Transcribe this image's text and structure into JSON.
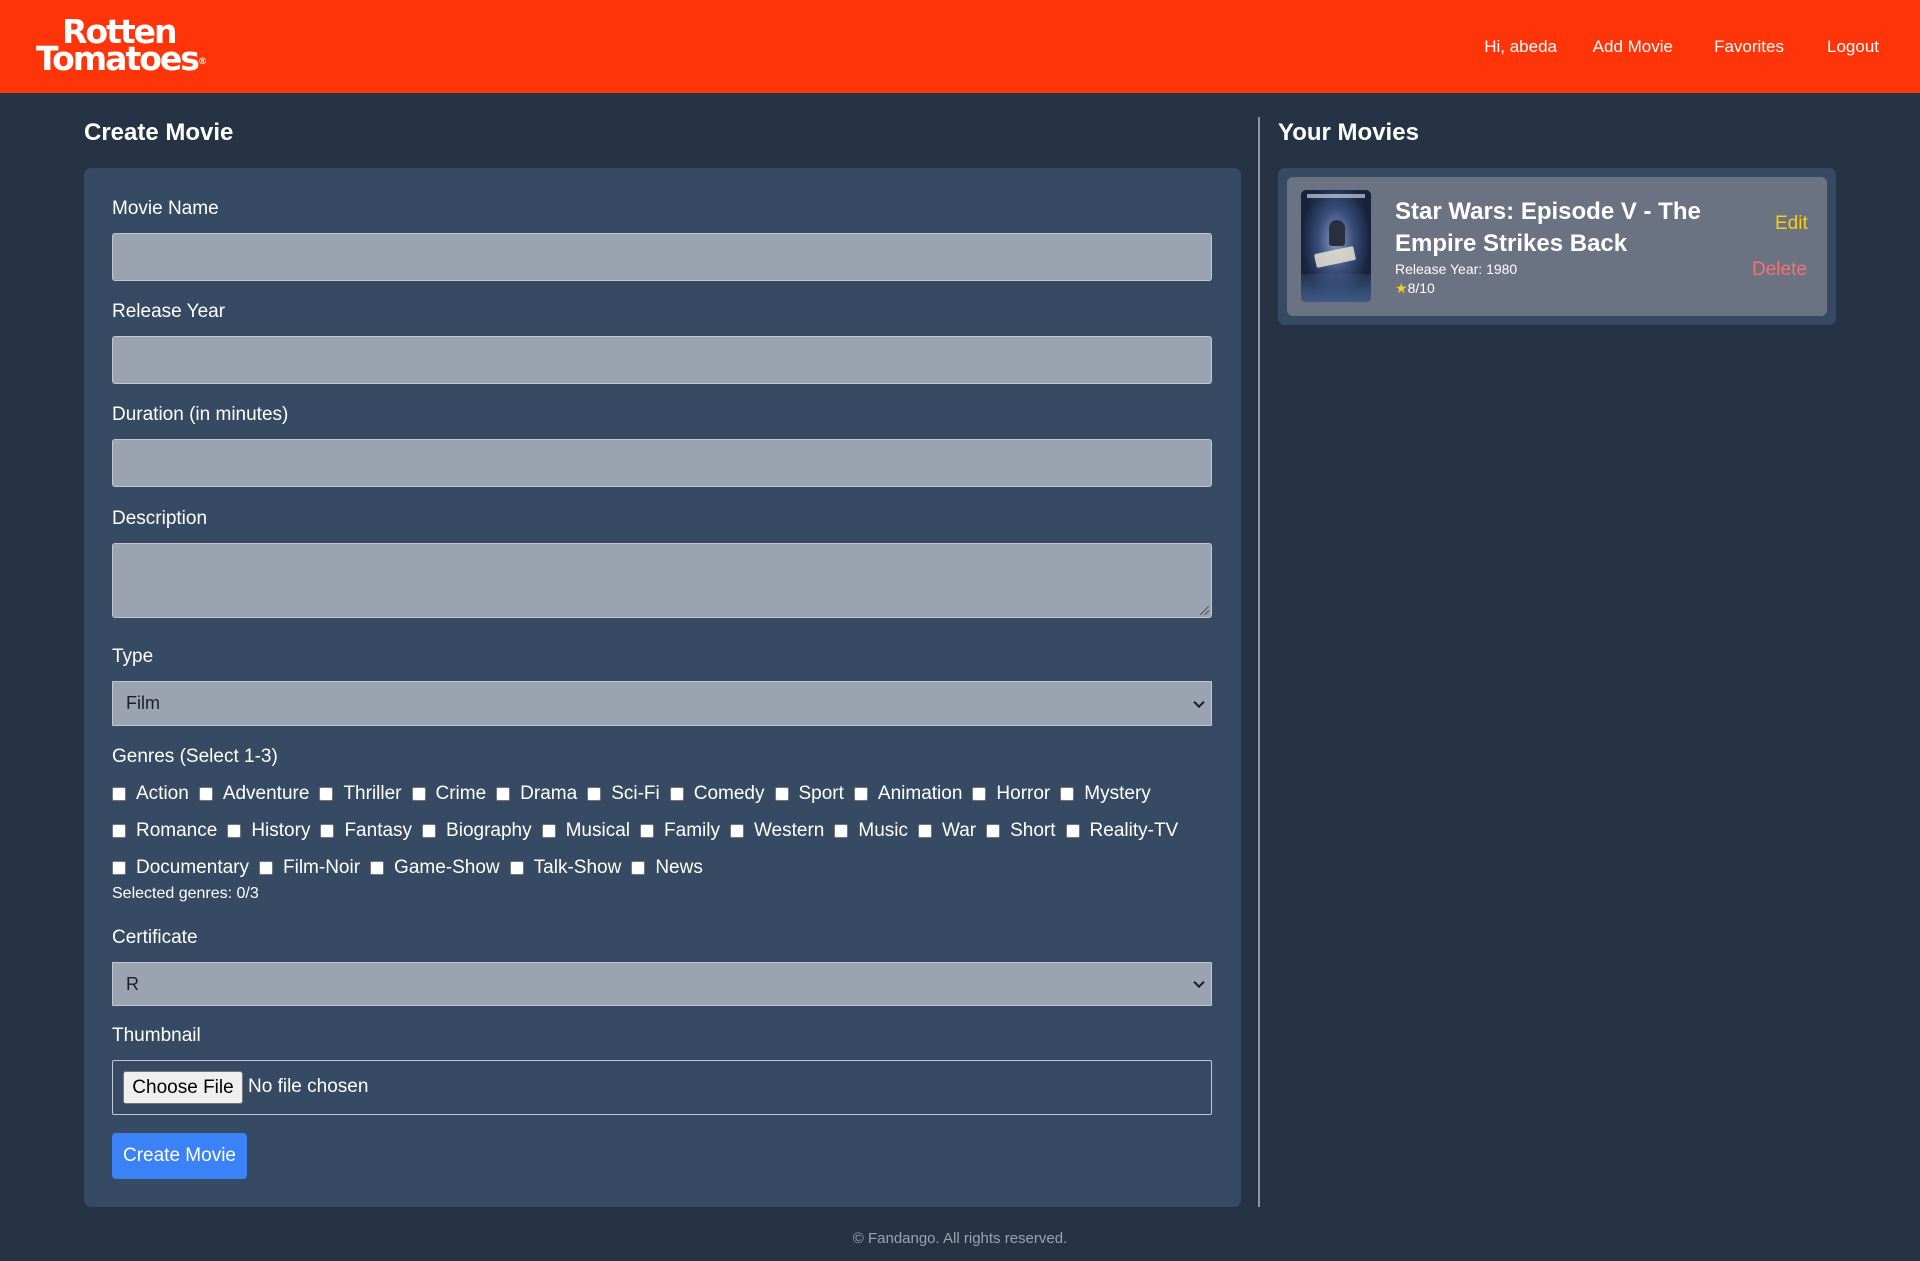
{
  "brand": {
    "logo_line1": "Rotten",
    "logo_line2": "Tomatoes",
    "logo_mark": "®",
    "color": "#ff3409"
  },
  "nav": {
    "greeting": "Hi, abeda",
    "add_movie": "Add Movie",
    "favorites": "Favorites",
    "logout": "Logout"
  },
  "create_form": {
    "title": "Create Movie",
    "movie_name": {
      "label": "Movie Name",
      "value": ""
    },
    "release_year": {
      "label": "Release Year",
      "value": ""
    },
    "duration": {
      "label": "Duration (in minutes)",
      "value": ""
    },
    "description": {
      "label": "Description",
      "value": ""
    },
    "type": {
      "label": "Type",
      "selected": "Film"
    },
    "genres": {
      "label": "Genres (Select 1-3)",
      "rows": [
        [
          "Action",
          "Adventure",
          "Thriller",
          "Crime",
          "Drama",
          "Sci-Fi",
          "Comedy",
          "Sport",
          "Animation",
          "Horror",
          "Mystery"
        ],
        [
          "Romance",
          "History",
          "Fantasy",
          "Biography",
          "Musical",
          "Family",
          "Western",
          "Music",
          "War",
          "Short",
          "Reality-TV"
        ],
        [
          "Documentary",
          "Film-Noir",
          "Game-Show",
          "Talk-Show",
          "News"
        ]
      ],
      "selected_count_text": "Selected genres: 0/3"
    },
    "certificate": {
      "label": "Certificate",
      "selected": "R"
    },
    "thumbnail": {
      "label": "Thumbnail",
      "button": "Choose File",
      "status": "No file chosen"
    },
    "submit": "Create Movie"
  },
  "your_movies": {
    "title": "Your Movies",
    "items": [
      {
        "title": "Star Wars: Episode V - The Empire Strikes Back",
        "release_year_text": "Release Year: 1980",
        "star": "★",
        "rating": "8/10",
        "edit": "Edit",
        "delete": "Delete"
      }
    ]
  },
  "footer": "© Fandango. All rights reserved.",
  "colors": {
    "background": "#263344",
    "card": "#374a63",
    "accent_button": "#3b82f6",
    "edit": "#facc15",
    "delete": "#f87171"
  }
}
